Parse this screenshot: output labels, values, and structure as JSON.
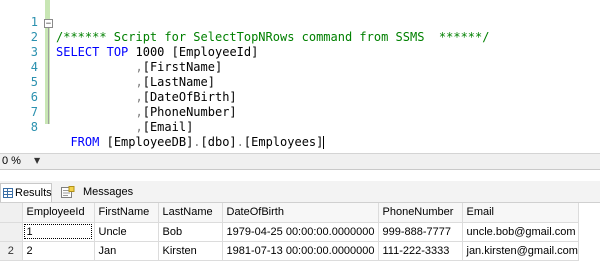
{
  "editor": {
    "line_numbers": [
      "1",
      "2",
      "3",
      "4",
      "5",
      "6",
      "7",
      "8"
    ],
    "line1_comment": "/****** Script for SelectTopNRows command from SSMS  ******/",
    "line2": {
      "select_kw": "SELECT",
      "top_kw": "TOP",
      "top_n": " 1000 ",
      "col": "[EmployeeId]"
    },
    "line3": {
      "comma": ",",
      "col": "[FirstName]"
    },
    "line4": {
      "comma": ",",
      "col": "[LastName]"
    },
    "line5": {
      "comma": ",",
      "col": "[DateOfBirth]"
    },
    "line6": {
      "comma": ",",
      "col": "[PhoneNumber]"
    },
    "line7": {
      "comma": ",",
      "col": "[Email]"
    },
    "line8": {
      "from_kw": "FROM",
      "db": "[EmployeeDB]",
      "dot1": ".",
      "schema": "[dbo]",
      "dot2": ".",
      "table": "[Employees]"
    }
  },
  "zoom": {
    "value": "0 %"
  },
  "tabs": {
    "results": "Results",
    "messages": "Messages"
  },
  "grid": {
    "columns": [
      "EmployeeId",
      "FirstName",
      "LastName",
      "DateOfBirth",
      "PhoneNumber",
      "Email"
    ],
    "rows": [
      {
        "rownum": "",
        "cells": [
          "1",
          "Uncle",
          "Bob",
          "1979-04-25 00:00:00.0000000",
          "999-888-7777",
          "uncle.bob@gmail.com"
        ]
      },
      {
        "rownum": "2",
        "cells": [
          "2",
          "Jan",
          "Kirsten",
          "1981-07-13 00:00:00.0000000",
          "111-222-3333",
          "jan.kirsten@gmail.com"
        ]
      }
    ]
  }
}
